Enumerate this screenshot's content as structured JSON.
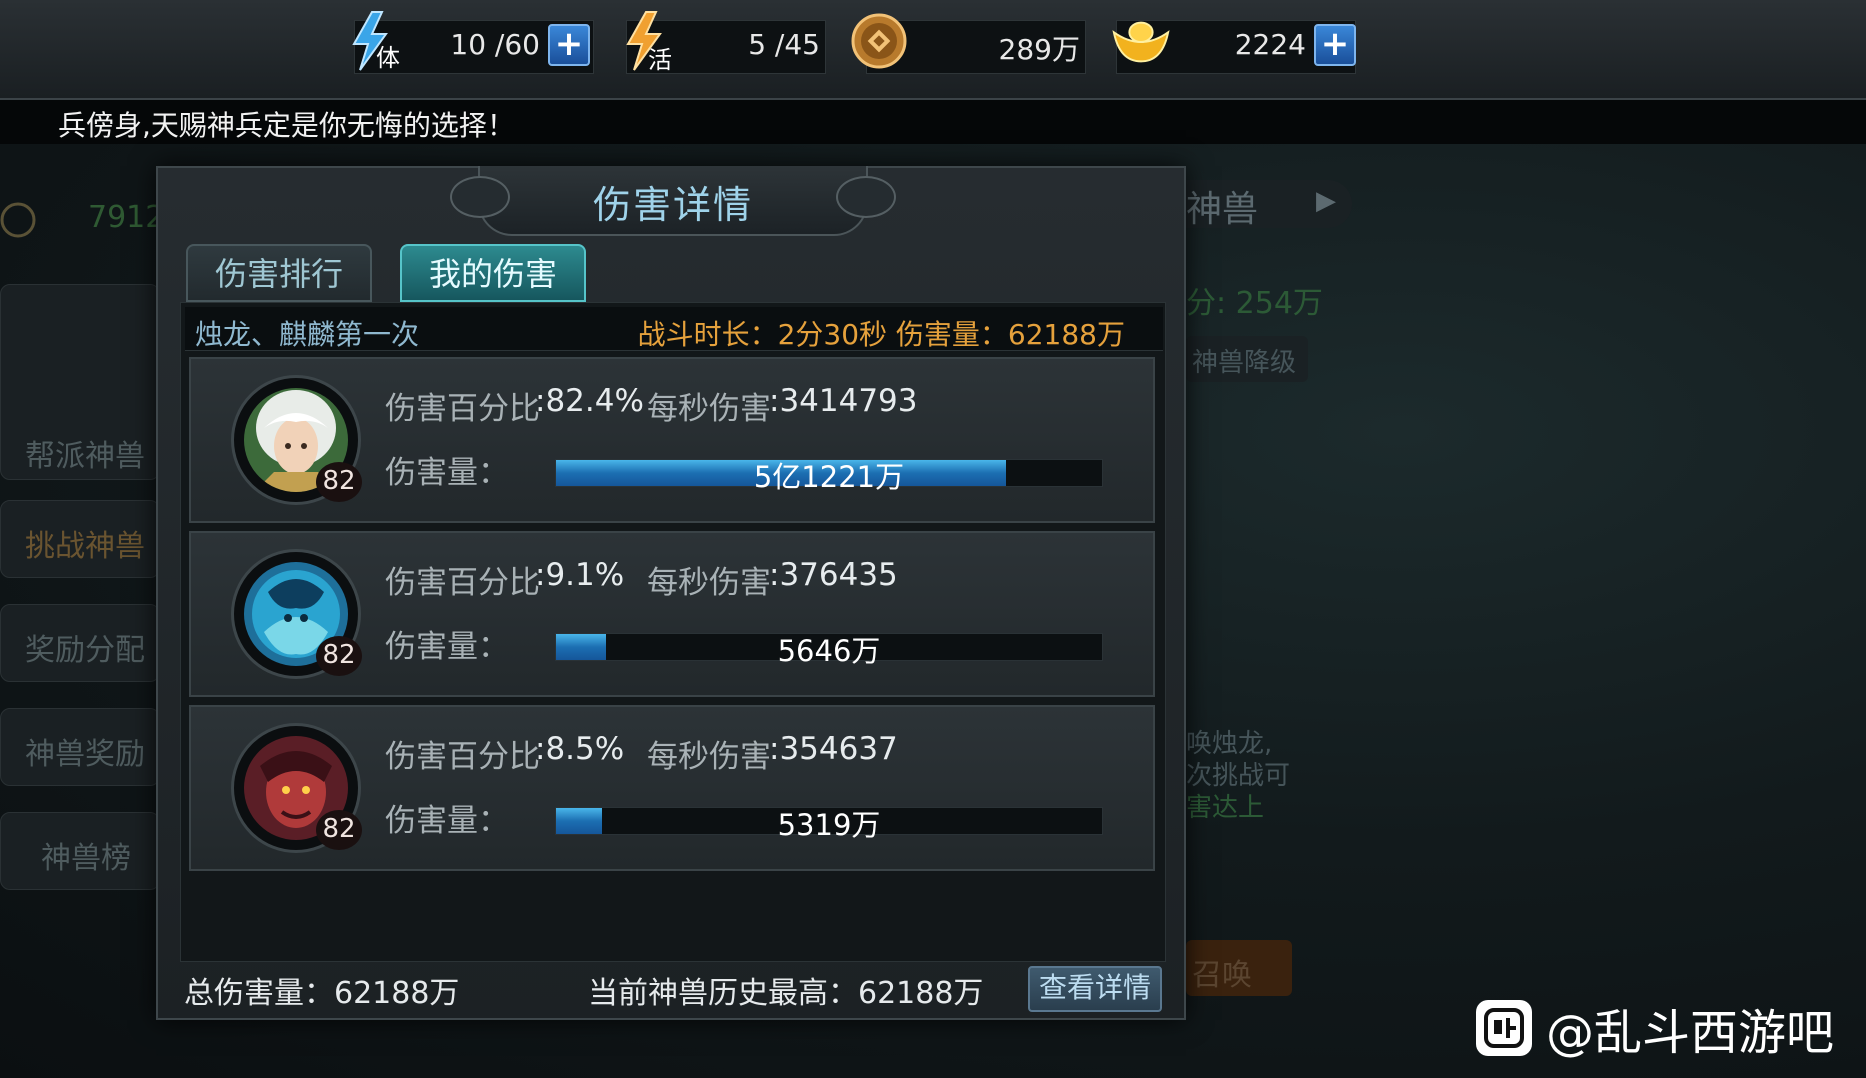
{
  "resources": {
    "stamina": {
      "icon_text": "体",
      "value": "10 /60"
    },
    "vitality": {
      "icon_text": "活",
      "value": "5 /45"
    },
    "coins": {
      "value": "289万"
    },
    "gold": {
      "value": "2224"
    }
  },
  "marquee": "兵傍身,天赐神兵定是你无悔的选择！",
  "background": {
    "left_menu": [
      "帮派神兽",
      "挑战神兽",
      "奖励分配",
      "神兽奖励",
      "神兽榜"
    ],
    "left_counter": "7912",
    "right_title": "神兽",
    "right_score": "分: 254万",
    "right_button": "神兽降级",
    "right_text": [
      "唤烛龙,",
      "次挑战可",
      "害达上"
    ],
    "right_action": "召唤"
  },
  "modal": {
    "title": "伤害详情",
    "tabs": [
      {
        "label": "伤害排行",
        "active": false
      },
      {
        "label": "我的伤害",
        "active": true
      }
    ],
    "battle_name": "烛龙、麒麟第一次",
    "battle_info": "战斗时长：2分30秒   伤害量：62188万",
    "labels": {
      "percent": "伤害百分比",
      "dps": "每秒伤害",
      "damage": "伤害量："
    },
    "rows": [
      {
        "level": "82",
        "percent": ":82.4%",
        "dps": ":3414793",
        "damage": "5亿1221万",
        "fill": 0.824
      },
      {
        "level": "82",
        "percent": ":9.1%",
        "dps": ":376435",
        "damage": "5646万",
        "fill": 0.091
      },
      {
        "level": "82",
        "percent": ":8.5%",
        "dps": ":354637",
        "damage": "5319万",
        "fill": 0.085
      }
    ],
    "total_damage": "总伤害量：62188万",
    "history_high": "当前神兽历史最高：62188万",
    "detail_button": "查看详情"
  },
  "watermark": "@乱斗西游吧"
}
